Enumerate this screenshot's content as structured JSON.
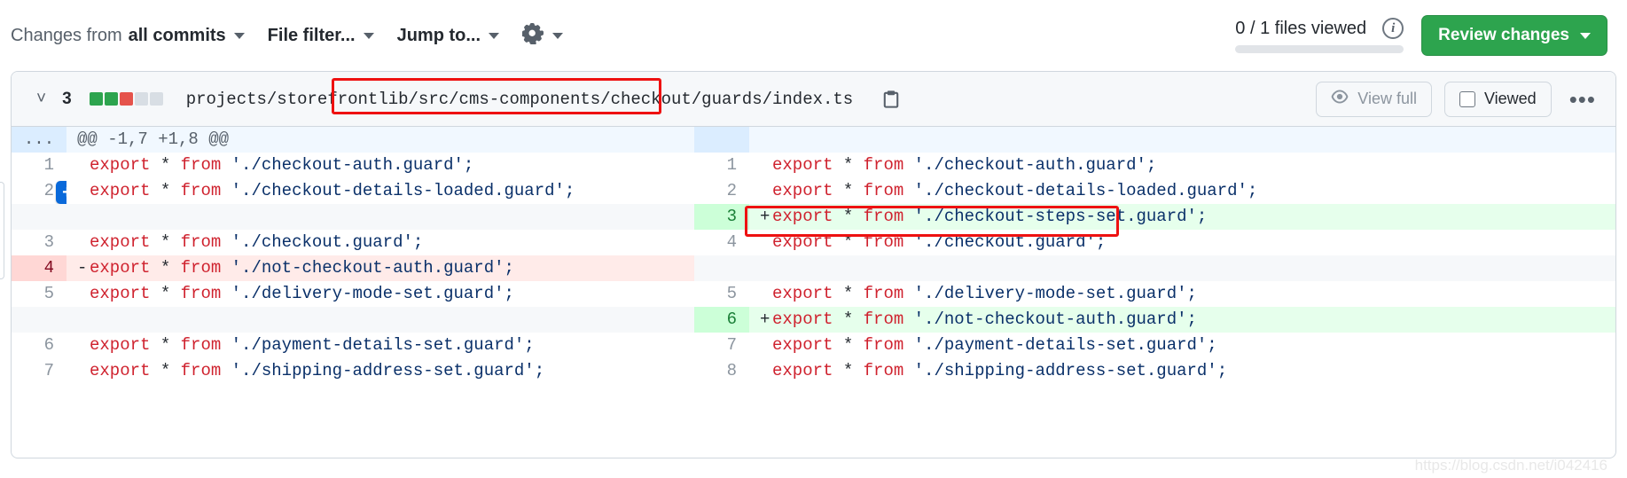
{
  "toolbar": {
    "changes_from_prefix": "Changes from",
    "changes_from_value": "all commits",
    "file_filter_label": "File filter...",
    "jump_to_label": "Jump to...",
    "gear_icon": "gear-icon",
    "caret_icon": "chevron-down-icon"
  },
  "review": {
    "files_viewed_text": "0 / 1 files viewed",
    "info_icon": "info-icon",
    "info_glyph": "i",
    "progress_percent": 0,
    "review_button_label": "Review changes",
    "accent_green": "#2da44e"
  },
  "file": {
    "collapse_icon": "chevron-down-icon",
    "changed_count": "3",
    "diffstat": [
      {
        "name": "diffstat-block-added",
        "color": "#2da44e"
      },
      {
        "name": "diffstat-block-added",
        "color": "#2da44e"
      },
      {
        "name": "diffstat-block-deleted",
        "color": "#e5534b"
      },
      {
        "name": "diffstat-block-neutral",
        "color": "#d8dee4"
      },
      {
        "name": "diffstat-block-neutral",
        "color": "#d8dee4"
      }
    ],
    "path": "projects/storefrontlib/src/cms-components/checkout/guards/index.ts",
    "copy_icon": "clipboard-icon",
    "view_full_label": "View full",
    "view_full_icon": "eye-icon",
    "viewed_label": "Viewed",
    "viewed_checked": false,
    "kebab_label": "•••"
  },
  "diff": {
    "hunk_header": "@@ -1,7 +1,8 @@",
    "hunk_expand_label": "...",
    "rows": [
      {
        "type": "hunk",
        "left_num": "...",
        "right_num": "",
        "left_code": "@@ -1,7 +1,8 @@",
        "right_code": ""
      },
      {
        "type": "ctx",
        "left_num": "1",
        "right_num": "1",
        "left_marker": "",
        "right_marker": "",
        "left_kw1": "export",
        "left_op": " * ",
        "left_kw2": "from",
        "left_str": " './checkout-auth.guard';",
        "right_kw1": "export",
        "right_op": " * ",
        "right_kw2": "from",
        "right_str": " './checkout-auth.guard';"
      },
      {
        "type": "ctx",
        "left_num": "2",
        "right_num": "2",
        "has_add_comment": true,
        "add_comment_glyph": "+",
        "left_marker": "",
        "right_marker": "",
        "left_kw1": "export",
        "left_op": " * ",
        "left_kw2": "from",
        "left_str": " './checkout-details-loaded.guard';",
        "right_kw1": "export",
        "right_op": " * ",
        "right_kw2": "from",
        "right_str": " './checkout-details-loaded.guard';"
      },
      {
        "type": "add",
        "left_num": "",
        "right_num": "3",
        "left_marker": "",
        "right_marker": "+",
        "left_kw1": "",
        "left_op": "",
        "left_kw2": "",
        "left_str": "",
        "right_kw1": "export",
        "right_op": " * ",
        "right_kw2": "from",
        "right_str": " './checkout-steps-set.guard';"
      },
      {
        "type": "ctx",
        "left_num": "3",
        "right_num": "4",
        "left_marker": "",
        "right_marker": "",
        "left_kw1": "export",
        "left_op": " * ",
        "left_kw2": "from",
        "left_str": " './checkout.guard';",
        "right_kw1": "export",
        "right_op": " * ",
        "right_kw2": "from",
        "right_str": " './checkout.guard';"
      },
      {
        "type": "del",
        "left_num": "4",
        "right_num": "",
        "left_marker": "-",
        "right_marker": "",
        "left_kw1": "export",
        "left_op": " * ",
        "left_kw2": "from",
        "left_str": " './not-checkout-auth.guard';",
        "right_kw1": "",
        "right_op": "",
        "right_kw2": "",
        "right_str": ""
      },
      {
        "type": "ctx",
        "left_num": "5",
        "right_num": "5",
        "left_marker": "",
        "right_marker": "",
        "left_kw1": "export",
        "left_op": " * ",
        "left_kw2": "from",
        "left_str": " './delivery-mode-set.guard';",
        "right_kw1": "export",
        "right_op": " * ",
        "right_kw2": "from",
        "right_str": " './delivery-mode-set.guard';"
      },
      {
        "type": "add",
        "left_num": "",
        "right_num": "6",
        "left_marker": "",
        "right_marker": "+",
        "left_kw1": "",
        "left_op": "",
        "left_kw2": "",
        "left_str": "",
        "right_kw1": "export",
        "right_op": " * ",
        "right_kw2": "from",
        "right_str": " './not-checkout-auth.guard';"
      },
      {
        "type": "ctx",
        "left_num": "6",
        "right_num": "7",
        "left_marker": "",
        "right_marker": "",
        "left_kw1": "export",
        "left_op": " * ",
        "left_kw2": "from",
        "left_str": " './payment-details-set.guard';",
        "right_kw1": "export",
        "right_op": " * ",
        "right_kw2": "from",
        "right_str": " './payment-details-set.guard';"
      },
      {
        "type": "ctx",
        "left_num": "7",
        "right_num": "8",
        "left_marker": "",
        "right_marker": "",
        "left_kw1": "export",
        "left_op": " * ",
        "left_kw2": "from",
        "left_str": " './shipping-address-set.guard';",
        "right_kw1": "export",
        "right_op": " * ",
        "right_kw2": "from",
        "right_str": " './shipping-address-set.guard';"
      }
    ]
  },
  "annotations": [
    {
      "name": "annotation-box-file-path"
    },
    {
      "name": "annotation-box-added-line"
    }
  ],
  "watermark": "https://blog.csdn.net/i042416"
}
